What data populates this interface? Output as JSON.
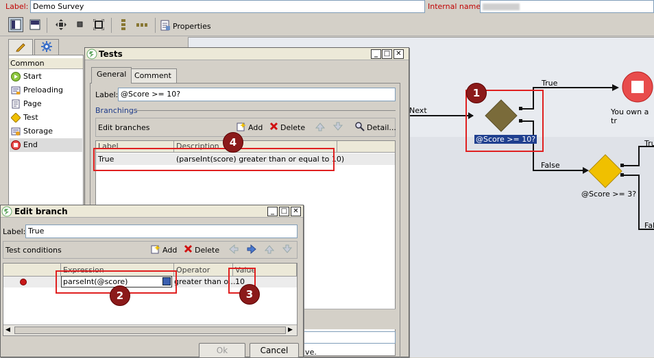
{
  "header": {
    "label_caption": "Label:",
    "label_value": "Demo Survey",
    "internal_caption": "Internal name:"
  },
  "toolbar": {
    "properties_label": "Properties"
  },
  "palette": {
    "section": "Common",
    "items": [
      {
        "label": "Start",
        "icon": "start-icon"
      },
      {
        "label": "Preloading",
        "icon": "preloading-icon"
      },
      {
        "label": "Page",
        "icon": "page-icon"
      },
      {
        "label": "Test",
        "icon": "test-icon"
      },
      {
        "label": "Storage",
        "icon": "storage-icon"
      },
      {
        "label": "End",
        "icon": "end-icon"
      }
    ]
  },
  "tests_window": {
    "title": "Tests",
    "tabs": [
      "General",
      "Comment"
    ],
    "label_caption": "Label:",
    "label_value": "@Score >= 10?",
    "branchings_title": "Branchings",
    "edit_branches": "Edit branches",
    "add": "Add",
    "delete": "Delete",
    "detail": "Detail...",
    "columns": [
      "Label",
      "Description"
    ],
    "rows": [
      {
        "label": "True",
        "description": "(parseInt(score) greater than or equal to 10)"
      }
    ],
    "footer_text": "ive."
  },
  "edit_branch_window": {
    "title": "Edit branch",
    "label_caption": "Label:",
    "label_value": "True",
    "test_conditions": "Test conditions",
    "add": "Add",
    "delete": "Delete",
    "columns": [
      "Expression",
      "Operator",
      "Value"
    ],
    "row": {
      "expression": "parseInt(@score)",
      "operator": "greater than o...",
      "value": "10"
    },
    "ok": "Ok",
    "cancel": "Cancel"
  },
  "workflow": {
    "next_label": "Next",
    "test1_label": "@Score >= 10?",
    "true_label": "True",
    "false_label": "False",
    "end_label": "You own a tr",
    "test2_label": "@Score >= 3?",
    "tr_label": "Tru",
    "fal_label": "Fal"
  },
  "badges": [
    "1",
    "2",
    "3",
    "4"
  ],
  "colors": {
    "highlight_red": "#e02020",
    "badge": "#8b1a1a",
    "test_active": "#7a6b3a",
    "test_idle": "#f0c000",
    "end_red": "#e84c4c"
  }
}
